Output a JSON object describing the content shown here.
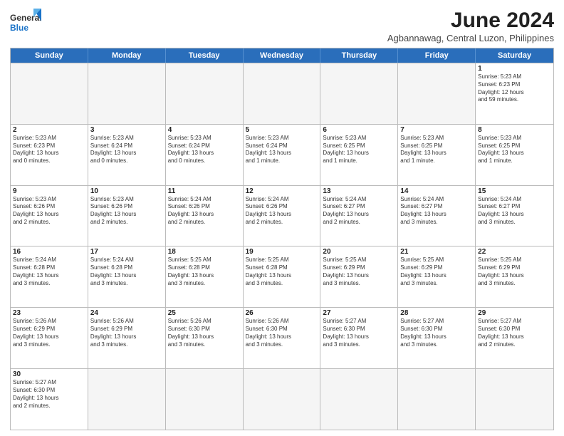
{
  "header": {
    "logo_general": "General",
    "logo_blue": "Blue",
    "title": "June 2024",
    "subtitle": "Agbannawag, Central Luzon, Philippines"
  },
  "calendar": {
    "weekdays": [
      "Sunday",
      "Monday",
      "Tuesday",
      "Wednesday",
      "Thursday",
      "Friday",
      "Saturday"
    ],
    "rows": [
      [
        {
          "day": "",
          "info": "",
          "empty": true
        },
        {
          "day": "",
          "info": "",
          "empty": true
        },
        {
          "day": "",
          "info": "",
          "empty": true
        },
        {
          "day": "",
          "info": "",
          "empty": true
        },
        {
          "day": "",
          "info": "",
          "empty": true
        },
        {
          "day": "",
          "info": "",
          "empty": true
        },
        {
          "day": "1",
          "info": "Sunrise: 5:23 AM\nSunset: 6:23 PM\nDaylight: 12 hours\nand 59 minutes.",
          "empty": false
        }
      ],
      [
        {
          "day": "2",
          "info": "Sunrise: 5:23 AM\nSunset: 6:23 PM\nDaylight: 13 hours\nand 0 minutes.",
          "empty": false
        },
        {
          "day": "3",
          "info": "Sunrise: 5:23 AM\nSunset: 6:24 PM\nDaylight: 13 hours\nand 0 minutes.",
          "empty": false
        },
        {
          "day": "4",
          "info": "Sunrise: 5:23 AM\nSunset: 6:24 PM\nDaylight: 13 hours\nand 0 minutes.",
          "empty": false
        },
        {
          "day": "5",
          "info": "Sunrise: 5:23 AM\nSunset: 6:24 PM\nDaylight: 13 hours\nand 1 minute.",
          "empty": false
        },
        {
          "day": "6",
          "info": "Sunrise: 5:23 AM\nSunset: 6:25 PM\nDaylight: 13 hours\nand 1 minute.",
          "empty": false
        },
        {
          "day": "7",
          "info": "Sunrise: 5:23 AM\nSunset: 6:25 PM\nDaylight: 13 hours\nand 1 minute.",
          "empty": false
        },
        {
          "day": "8",
          "info": "Sunrise: 5:23 AM\nSunset: 6:25 PM\nDaylight: 13 hours\nand 1 minute.",
          "empty": false
        }
      ],
      [
        {
          "day": "9",
          "info": "Sunrise: 5:23 AM\nSunset: 6:26 PM\nDaylight: 13 hours\nand 2 minutes.",
          "empty": false
        },
        {
          "day": "10",
          "info": "Sunrise: 5:23 AM\nSunset: 6:26 PM\nDaylight: 13 hours\nand 2 minutes.",
          "empty": false
        },
        {
          "day": "11",
          "info": "Sunrise: 5:24 AM\nSunset: 6:26 PM\nDaylight: 13 hours\nand 2 minutes.",
          "empty": false
        },
        {
          "day": "12",
          "info": "Sunrise: 5:24 AM\nSunset: 6:26 PM\nDaylight: 13 hours\nand 2 minutes.",
          "empty": false
        },
        {
          "day": "13",
          "info": "Sunrise: 5:24 AM\nSunset: 6:27 PM\nDaylight: 13 hours\nand 2 minutes.",
          "empty": false
        },
        {
          "day": "14",
          "info": "Sunrise: 5:24 AM\nSunset: 6:27 PM\nDaylight: 13 hours\nand 3 minutes.",
          "empty": false
        },
        {
          "day": "15",
          "info": "Sunrise: 5:24 AM\nSunset: 6:27 PM\nDaylight: 13 hours\nand 3 minutes.",
          "empty": false
        }
      ],
      [
        {
          "day": "16",
          "info": "Sunrise: 5:24 AM\nSunset: 6:28 PM\nDaylight: 13 hours\nand 3 minutes.",
          "empty": false
        },
        {
          "day": "17",
          "info": "Sunrise: 5:24 AM\nSunset: 6:28 PM\nDaylight: 13 hours\nand 3 minutes.",
          "empty": false
        },
        {
          "day": "18",
          "info": "Sunrise: 5:25 AM\nSunset: 6:28 PM\nDaylight: 13 hours\nand 3 minutes.",
          "empty": false
        },
        {
          "day": "19",
          "info": "Sunrise: 5:25 AM\nSunset: 6:28 PM\nDaylight: 13 hours\nand 3 minutes.",
          "empty": false
        },
        {
          "day": "20",
          "info": "Sunrise: 5:25 AM\nSunset: 6:29 PM\nDaylight: 13 hours\nand 3 minutes.",
          "empty": false
        },
        {
          "day": "21",
          "info": "Sunrise: 5:25 AM\nSunset: 6:29 PM\nDaylight: 13 hours\nand 3 minutes.",
          "empty": false
        },
        {
          "day": "22",
          "info": "Sunrise: 5:25 AM\nSunset: 6:29 PM\nDaylight: 13 hours\nand 3 minutes.",
          "empty": false
        }
      ],
      [
        {
          "day": "23",
          "info": "Sunrise: 5:26 AM\nSunset: 6:29 PM\nDaylight: 13 hours\nand 3 minutes.",
          "empty": false
        },
        {
          "day": "24",
          "info": "Sunrise: 5:26 AM\nSunset: 6:29 PM\nDaylight: 13 hours\nand 3 minutes.",
          "empty": false
        },
        {
          "day": "25",
          "info": "Sunrise: 5:26 AM\nSunset: 6:30 PM\nDaylight: 13 hours\nand 3 minutes.",
          "empty": false
        },
        {
          "day": "26",
          "info": "Sunrise: 5:26 AM\nSunset: 6:30 PM\nDaylight: 13 hours\nand 3 minutes.",
          "empty": false
        },
        {
          "day": "27",
          "info": "Sunrise: 5:27 AM\nSunset: 6:30 PM\nDaylight: 13 hours\nand 3 minutes.",
          "empty": false
        },
        {
          "day": "28",
          "info": "Sunrise: 5:27 AM\nSunset: 6:30 PM\nDaylight: 13 hours\nand 3 minutes.",
          "empty": false
        },
        {
          "day": "29",
          "info": "Sunrise: 5:27 AM\nSunset: 6:30 PM\nDaylight: 13 hours\nand 2 minutes.",
          "empty": false
        }
      ],
      [
        {
          "day": "30",
          "info": "Sunrise: 5:27 AM\nSunset: 6:30 PM\nDaylight: 13 hours\nand 2 minutes.",
          "empty": false
        },
        {
          "day": "",
          "info": "",
          "empty": true
        },
        {
          "day": "",
          "info": "",
          "empty": true
        },
        {
          "day": "",
          "info": "",
          "empty": true
        },
        {
          "day": "",
          "info": "",
          "empty": true
        },
        {
          "day": "",
          "info": "",
          "empty": true
        },
        {
          "day": "",
          "info": "",
          "empty": true
        }
      ]
    ]
  }
}
